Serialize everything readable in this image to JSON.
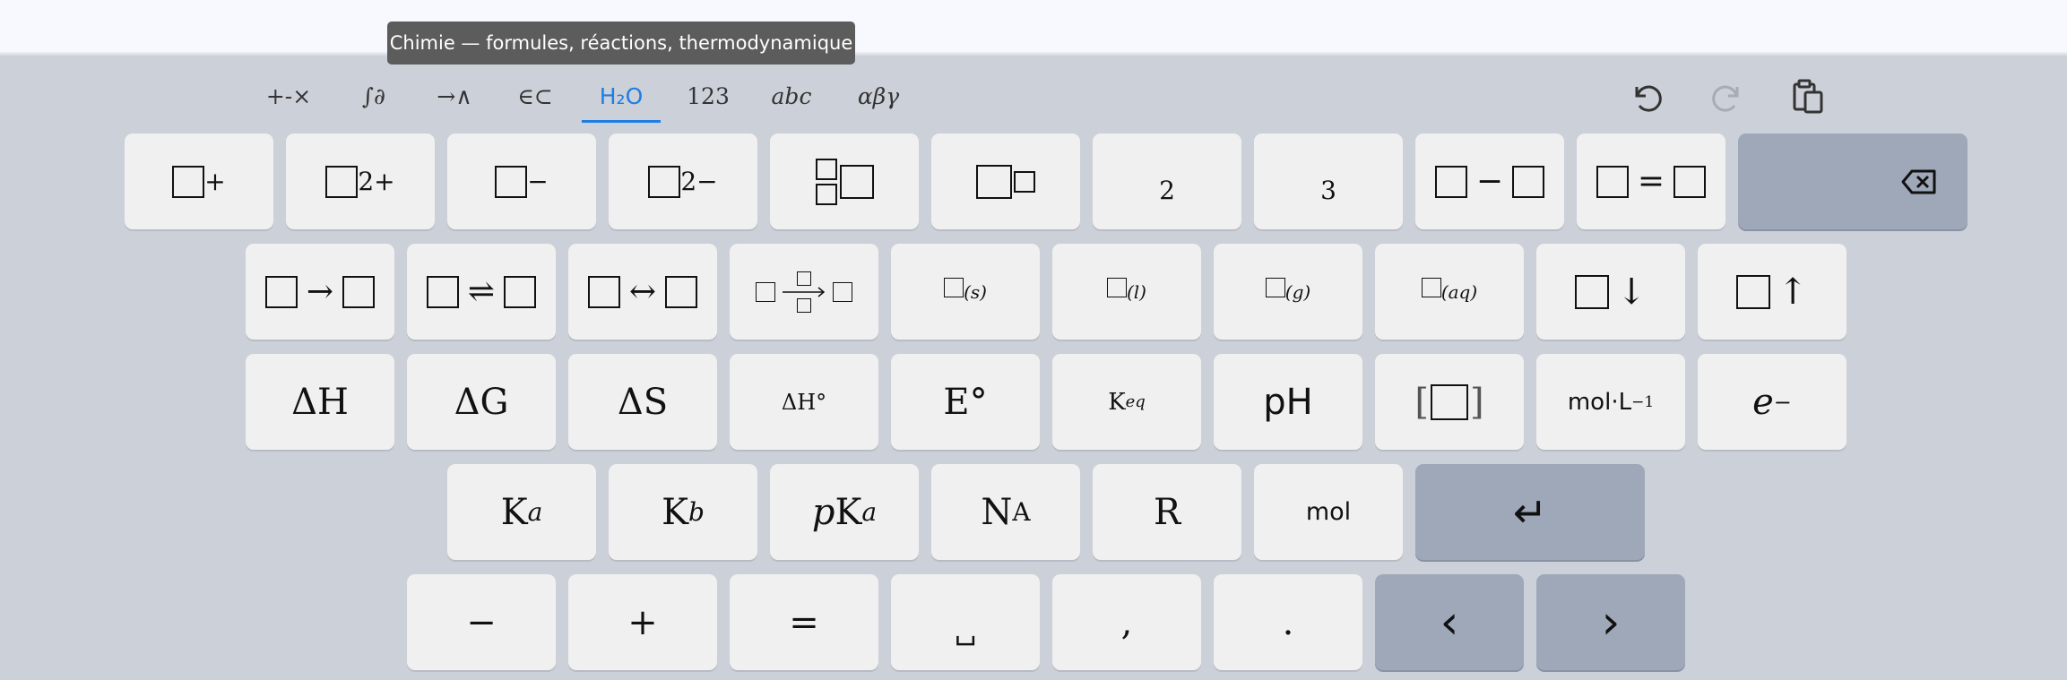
{
  "tooltip": "Chimie — formules, réactions, thermodynamique",
  "tabs": [
    {
      "label": "+-×"
    },
    {
      "label": "∫∂"
    },
    {
      "label": "→∧"
    },
    {
      "label": "∈⊂"
    },
    {
      "label": "H₂O"
    },
    {
      "label": "123"
    },
    {
      "label": "abc"
    },
    {
      "label": "αβγ"
    }
  ],
  "active_tab": "H₂O",
  "keys": {
    "charge_plus": "+",
    "charge_2plus": "2+",
    "charge_minus": "−",
    "charge_2minus": "2−",
    "sub_two": "2",
    "sub_three": "3",
    "bond_minus": "−",
    "bond_equals": "=",
    "arrow_right": "→",
    "equilibrium": "⇌",
    "resonance": "↔",
    "state_s": "(s)",
    "state_l": "(l)",
    "state_g": "(g)",
    "state_aq": "(aq)",
    "precipitate": "↓",
    "gas": "↑",
    "delta_h": "ΔH",
    "delta_g": "ΔG",
    "delta_s": "ΔS",
    "delta_h_std": "ΔH°",
    "e_std": "E°",
    "keq_base": "K",
    "keq_sub": "eq",
    "ph": "pH",
    "concentration_l": "[",
    "concentration_r": "]",
    "mol_per_l": "mol·L",
    "mol_per_l_exp": "−1",
    "electron_base": "e",
    "electron_sup": "−",
    "ka_base": "K",
    "ka_sub": "a",
    "kb_base": "K",
    "kb_sub": "b",
    "pka_p": "p",
    "pka_k": "K",
    "pka_sub": "a",
    "na_base": "N",
    "na_sub": "A",
    "r": "R",
    "mol": "mol",
    "enter": "↵",
    "minus": "−",
    "plus": "+",
    "equals": "=",
    "space": "␣",
    "comma": ",",
    "period": ".",
    "left": "‹",
    "right": "›"
  },
  "colors": {
    "keyboard_bg": "#ccd0d8",
    "key_bg": "#f0f0f0",
    "key_dark": "#9ea8b8",
    "accent": "#1e7ee4",
    "tooltip_bg": "#5c5c5c"
  }
}
